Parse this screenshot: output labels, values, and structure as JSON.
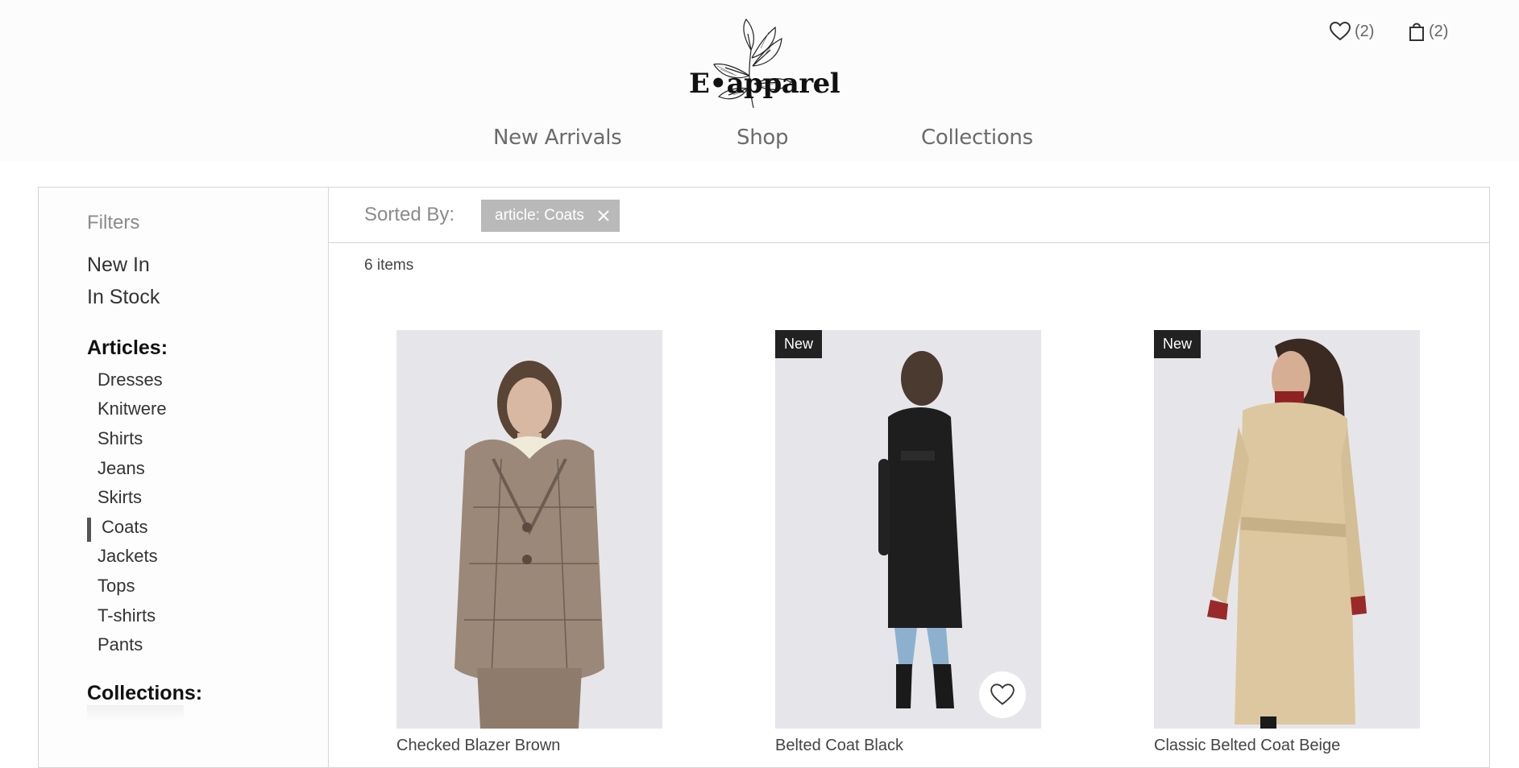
{
  "brand": {
    "name": "E•apparel"
  },
  "header": {
    "wishlist_count": "(2)",
    "cart_count": "(2)"
  },
  "nav": {
    "items": [
      {
        "label": "New Arrivals"
      },
      {
        "label": "Shop"
      },
      {
        "label": "Collections"
      }
    ]
  },
  "sidebar": {
    "filters_title": "Filters",
    "quick_filters": [
      {
        "label": "New In"
      },
      {
        "label": "In Stock"
      }
    ],
    "articles_heading": "Articles:",
    "articles": [
      {
        "label": "Dresses"
      },
      {
        "label": "Knitwere"
      },
      {
        "label": "Shirts"
      },
      {
        "label": "Jeans"
      },
      {
        "label": "Skirts"
      },
      {
        "label": "Coats",
        "active": true
      },
      {
        "label": "Jackets"
      },
      {
        "label": "Tops"
      },
      {
        "label": "T-shirts"
      },
      {
        "label": "Pants"
      }
    ],
    "collections_heading": "Collections:"
  },
  "sortbar": {
    "label": "Sorted By:",
    "chip_label": "article: Coats"
  },
  "results": {
    "count_text": "6 items",
    "products": [
      {
        "name": "Checked Blazer Brown",
        "badge": ""
      },
      {
        "name": "Belted Coat Black",
        "badge": "New"
      },
      {
        "name": "Classic Belted Coat Beige",
        "badge": "New"
      }
    ]
  },
  "icons": {
    "wishlist": "heart-icon",
    "cart": "shopping-bag-icon",
    "chip_close": "close-icon",
    "favorite": "heart-icon"
  },
  "colors": {
    "chip_bg": "#b9b9b9",
    "badge_bg": "#222222",
    "image_bg": "#e6e6ea",
    "nav_text": "#6b6b6b"
  }
}
